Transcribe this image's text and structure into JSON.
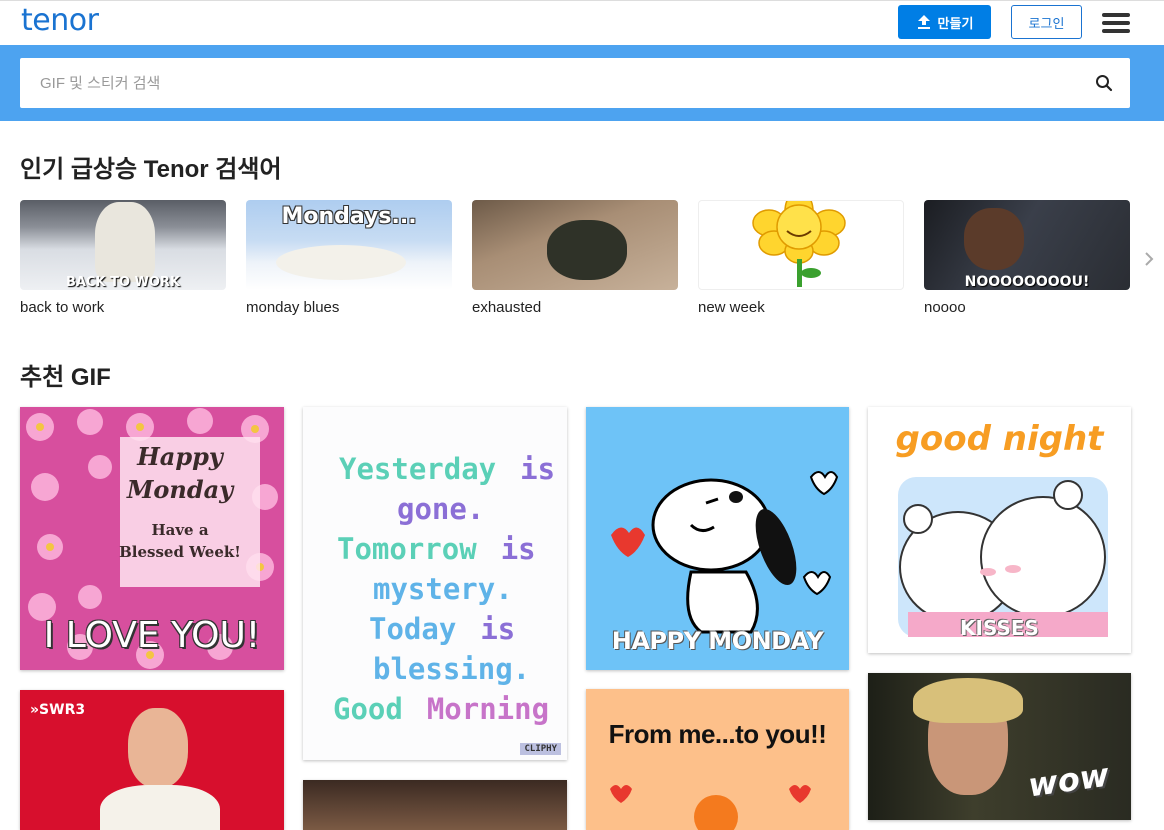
{
  "header": {
    "logo": "tenor",
    "create_label": "만들기",
    "login_label": "로그인"
  },
  "search": {
    "placeholder": "GIF 및 스티커 검색"
  },
  "trending": {
    "title": "인기 급상승 Tenor 검색어",
    "items": [
      {
        "label": "back to work",
        "overlay": "BACK TO WORK"
      },
      {
        "label": "monday blues",
        "overlay": "Mondays..."
      },
      {
        "label": "exhausted"
      },
      {
        "label": "new week"
      },
      {
        "label": "noooo",
        "overlay": "NOOOOOOOOU!"
      }
    ]
  },
  "recommended": {
    "title": "추천 GIF",
    "gifs": {
      "happy_monday": {
        "line1": "Happy",
        "line2": "Monday",
        "line3": "Have a",
        "line4": "Blessed Week!",
        "bottom": "I LOVE YOU!"
      },
      "yesterday": {
        "l1a": "Yesterday",
        "l1b": "is",
        "l2": "gone.",
        "l3a": "Tomorrow",
        "l3b": "is",
        "l4": "mystery.",
        "l5a": "Today",
        "l5b": "is",
        "l6": "blessing.",
        "l7a": "Good",
        "l7b": "Morning",
        "badge": "CLIPHY"
      },
      "snoopy": {
        "caption": "HAPPY MONDAY"
      },
      "goodnight": {
        "title": "good night",
        "caption": "KISSES"
      },
      "swr3": {
        "badge": "»SWR3"
      },
      "from_me": {
        "caption": "From me...to you!!"
      },
      "wow": {
        "caption": "wow"
      }
    }
  }
}
